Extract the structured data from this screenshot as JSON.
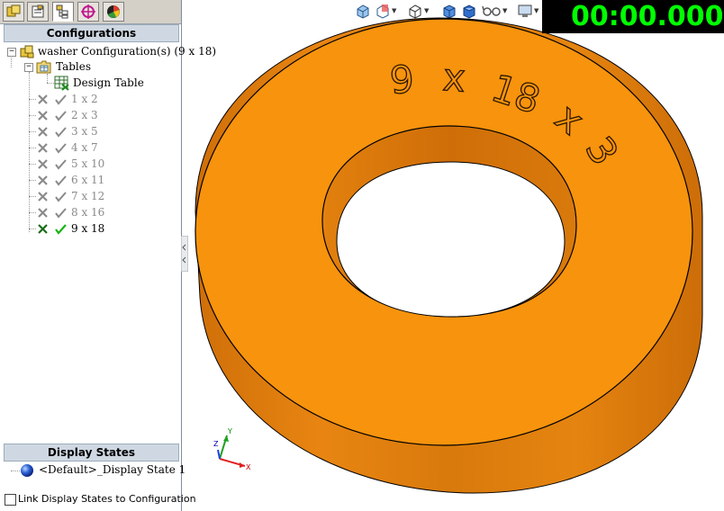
{
  "tabs": [
    {
      "icon": "feature-manager-icon"
    },
    {
      "icon": "property-manager-icon"
    },
    {
      "icon": "configuration-manager-icon"
    },
    {
      "icon": "dimxpert-icon"
    },
    {
      "icon": "display-manager-icon"
    }
  ],
  "configurations_header": "Configurations",
  "tree": {
    "root_label": "washer Configuration(s)  (9 x 18)",
    "tables_label": "Tables",
    "design_table_label": "Design Table",
    "configs": [
      {
        "label": "1 x 2",
        "active": false
      },
      {
        "label": "2 x 3",
        "active": false
      },
      {
        "label": "3 x 5",
        "active": false
      },
      {
        "label": "4 x 7",
        "active": false
      },
      {
        "label": "5 x 10",
        "active": false
      },
      {
        "label": "6 x 11",
        "active": false
      },
      {
        "label": "7 x 12",
        "active": false
      },
      {
        "label": "8 x 16",
        "active": false
      },
      {
        "label": "9 x 18",
        "active": true
      }
    ]
  },
  "display_states_header": "Display States",
  "display_state_label": "<Default>_Display State 1",
  "link_checkbox_label": "Link Display States to Configuration",
  "timer": "00:00.000",
  "timer_tail": "▯",
  "model_engraving": [
    "9",
    "x",
    "18",
    "x",
    "3"
  ],
  "triad": {
    "x": "X",
    "y": "Y",
    "z": "Z"
  },
  "colors": {
    "washer_face": "#f7930d",
    "washer_side": "#d9770a",
    "timer_text": "#00ff00",
    "header_bg": "#cfd8e2"
  }
}
